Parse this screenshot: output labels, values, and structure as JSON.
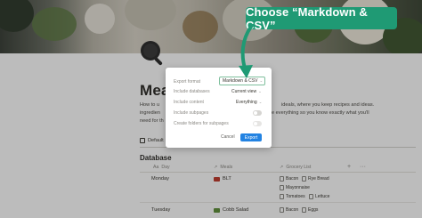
{
  "page": {
    "title": "Mea",
    "description_left": [
      "How to u",
      "ingredien",
      "need for th"
    ],
    "description_right": [
      "ideals, where you keep recipes and ideas.",
      "e everything so you know exactly what you'll"
    ],
    "view_tab": "Default",
    "database_title": "Database"
  },
  "table": {
    "columns": [
      "Day",
      "Meals",
      "Grocery List"
    ],
    "rows": [
      {
        "day": "Monday",
        "meal": "BLT",
        "groceries": [
          "Bacon",
          "Rye Bread",
          "Mayonnaise",
          "Tomatoes",
          "Lettuce"
        ]
      },
      {
        "day": "Tuesday",
        "meal": "Cobb Salad",
        "groceries": [
          "Bacon",
          "Eggs"
        ]
      }
    ]
  },
  "modal": {
    "rows": [
      {
        "label": "Export format",
        "value": "Markdown & CSV"
      },
      {
        "label": "Include databases",
        "value": "Current view"
      },
      {
        "label": "Include content",
        "value": "Everything"
      },
      {
        "label": "Include subpages",
        "value": ""
      },
      {
        "label": "Create folders for subpages",
        "value": ""
      }
    ],
    "cancel_label": "Cancel",
    "export_label": "Export"
  },
  "callout": {
    "text": "Choose “Markdown & CSV”"
  },
  "colors": {
    "accent": "#1f9a74",
    "export_button": "#2383e2",
    "meal_icon_blt": "#c0392b",
    "meal_icon_cobb": "#5f8f3a"
  }
}
